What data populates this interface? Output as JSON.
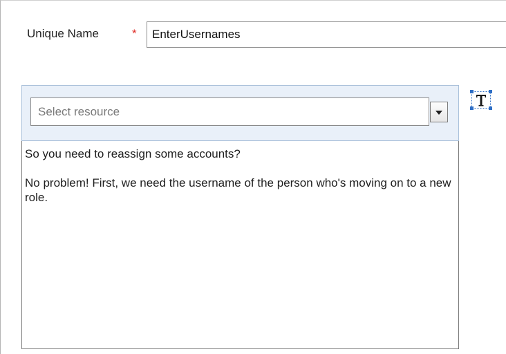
{
  "form": {
    "unique_name_label": "Unique Name",
    "required_marker": "*",
    "unique_name_value": "EnterUsernames"
  },
  "resource": {
    "placeholder": "Select resource"
  },
  "toolbar": {
    "text_tool_icon": "text-format-icon"
  },
  "message": {
    "line1": "So you need to reassign some accounts?",
    "line2": "No problem! First, we need the username of the person who's moving on to a new role."
  },
  "colors": {
    "required": "#e0302a",
    "resource_bar_bg": "#e9f0f9",
    "icon_accent": "#2f6fc6"
  }
}
